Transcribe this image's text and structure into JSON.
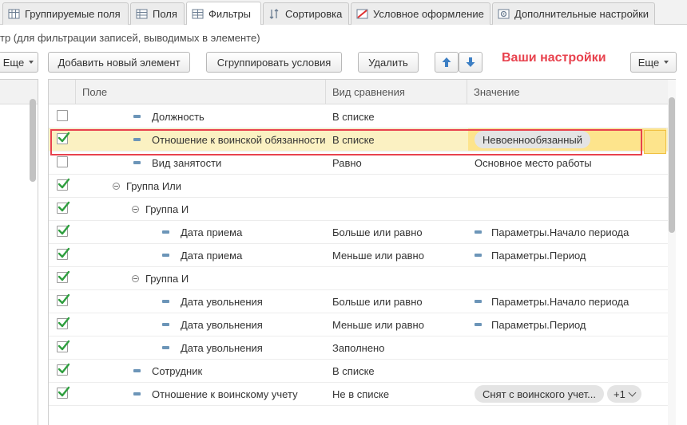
{
  "tabs": [
    {
      "label": "Группируемые поля",
      "icon": "grid-icon",
      "active": false
    },
    {
      "label": "Поля",
      "icon": "fields-icon",
      "active": false
    },
    {
      "label": "Фильтры",
      "icon": "filter-icon",
      "active": true
    },
    {
      "label": "Сортировка",
      "icon": "sort-icon",
      "active": false
    },
    {
      "label": "Условное оформление",
      "icon": "conditional-format-icon",
      "active": false
    },
    {
      "label": "Дополнительные настройки",
      "icon": "settings-icon",
      "active": false
    }
  ],
  "description": "тр (для фильтрации записей, выводимых в элементе)",
  "toolbar": {
    "more_left": "Еще",
    "add_new": "Добавить новый элемент",
    "group_conditions": "Сгруппировать условия",
    "delete": "Удалить",
    "settings_label": "Ваши настройки",
    "more_right": "Еще"
  },
  "grid": {
    "columns": [
      "Поле",
      "Вид сравнения",
      "Значение"
    ],
    "rows": [
      {
        "checked": false,
        "indent": 1,
        "kind": "field",
        "field": "Должность",
        "comparison": "В списке",
        "value": "",
        "value_type": "none"
      },
      {
        "checked": true,
        "indent": 1,
        "kind": "field",
        "field": "Отношение к воинской обязанности",
        "comparison": "В списке",
        "value": "Невоеннообязанный",
        "value_type": "pill",
        "selected": true
      },
      {
        "checked": false,
        "indent": 1,
        "kind": "field",
        "field": "Вид занятости",
        "comparison": "Равно",
        "value": "Основное место работы",
        "value_type": "text"
      },
      {
        "checked": true,
        "indent": 0,
        "kind": "group",
        "field": "Группа Или",
        "comparison": "",
        "value": "",
        "value_type": "none"
      },
      {
        "checked": true,
        "indent": 1,
        "kind": "group",
        "field": "Группа И",
        "comparison": "",
        "value": "",
        "value_type": "none"
      },
      {
        "checked": true,
        "indent": 2,
        "kind": "field",
        "field": "Дата приема",
        "comparison": "Больше или равно",
        "value": "Параметры.Начало периода",
        "value_type": "param"
      },
      {
        "checked": true,
        "indent": 2,
        "kind": "field",
        "field": "Дата приема",
        "comparison": "Меньше или равно",
        "value": "Параметры.Период",
        "value_type": "param"
      },
      {
        "checked": true,
        "indent": 1,
        "kind": "group",
        "field": "Группа И",
        "comparison": "",
        "value": "",
        "value_type": "none"
      },
      {
        "checked": true,
        "indent": 2,
        "kind": "field",
        "field": "Дата увольнения",
        "comparison": "Больше или равно",
        "value": "Параметры.Начало периода",
        "value_type": "param"
      },
      {
        "checked": true,
        "indent": 2,
        "kind": "field",
        "field": "Дата увольнения",
        "comparison": "Меньше или равно",
        "value": "Параметры.Период",
        "value_type": "param"
      },
      {
        "checked": true,
        "indent": 2,
        "kind": "field",
        "field": "Дата увольнения",
        "comparison": "Заполнено",
        "value": "",
        "value_type": "none"
      },
      {
        "checked": true,
        "indent": 1,
        "kind": "field",
        "field": "Сотрудник",
        "comparison": "В списке",
        "value": "",
        "value_type": "none"
      },
      {
        "checked": true,
        "indent": 1,
        "kind": "field",
        "field": "Отношение к воинскому учету",
        "comparison": "Не в списке",
        "value": "Снят с воинского учет...",
        "value_type": "pill",
        "extra": "+1"
      }
    ]
  },
  "colors": {
    "accent_red": "#e8424e",
    "check_green": "#2e9e3e",
    "selected_row": "#fbf1c2",
    "selected_cell": "#fde48c",
    "arrow_blue": "#3d7fc4"
  }
}
